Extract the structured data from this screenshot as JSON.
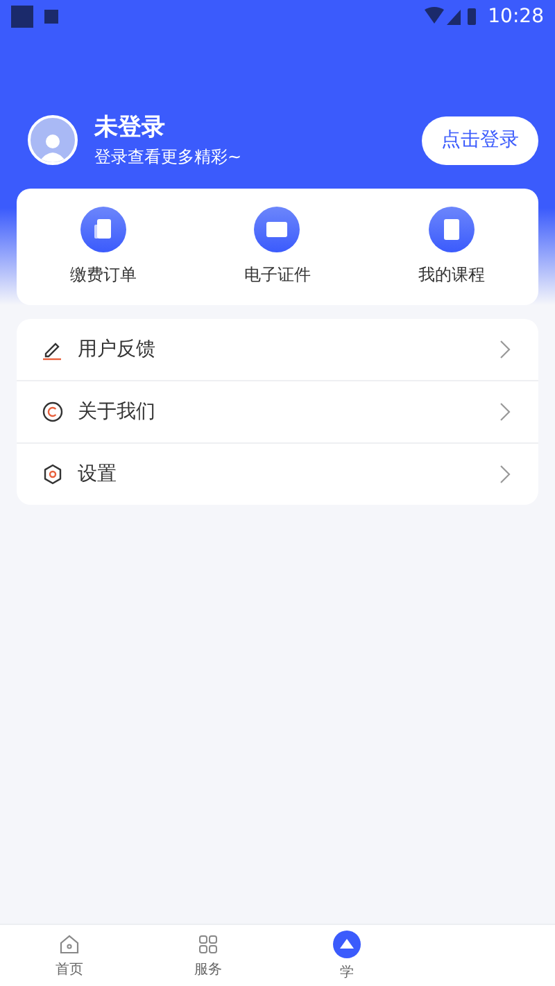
{
  "status_bar": {
    "time": "10:28"
  },
  "profile": {
    "name": "未登录",
    "subtitle": "登录查看更多精彩~",
    "login_button": "点击登录"
  },
  "shortcuts": [
    {
      "label": "缴费订单",
      "kind": "receipt"
    },
    {
      "label": "电子证件",
      "kind": "id-card"
    },
    {
      "label": "我的课程",
      "kind": "book"
    }
  ],
  "menu": [
    {
      "label": "用户反馈",
      "kind": "pen"
    },
    {
      "label": "关于我们",
      "kind": "copyright"
    },
    {
      "label": "设置",
      "kind": "gear"
    }
  ],
  "tab_bar": [
    {
      "label": "首页",
      "kind": "home",
      "selected": false
    },
    {
      "label": "服务",
      "kind": "grid",
      "selected": false
    },
    {
      "label": "学",
      "kind": "center",
      "selected": false
    }
  ]
}
